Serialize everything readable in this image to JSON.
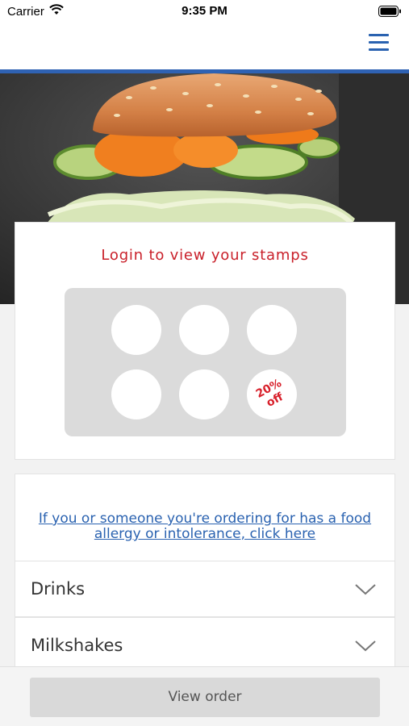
{
  "status_bar": {
    "carrier": "Carrier",
    "time": "9:35 PM"
  },
  "header": {
    "menu_icon": "hamburger-menu-icon",
    "accent_color": "#2f62b3"
  },
  "hero": {
    "image": "burger-photo"
  },
  "stamp_card": {
    "title": "Login to view your stamps",
    "stamps_total": 6,
    "reward_label_line1": "20%",
    "reward_label_line2": "off",
    "title_color": "#c9202a"
  },
  "allergy": {
    "link_text": "If you or someone you're ordering for has a food allergy or intolerance, click here"
  },
  "categories": [
    {
      "label": "Drinks",
      "icon": "chevron-down-icon"
    },
    {
      "label": "Milkshakes",
      "icon": "chevron-down-icon"
    }
  ],
  "footer": {
    "view_order_label": "View order"
  }
}
